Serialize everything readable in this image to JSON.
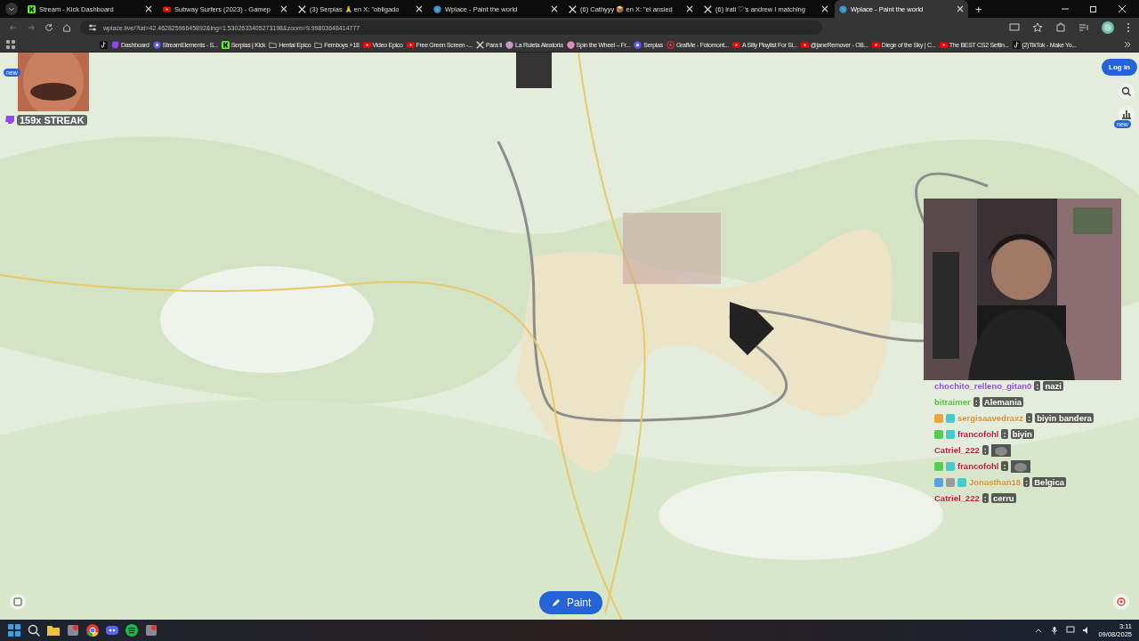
{
  "browser": {
    "tabs": [
      {
        "title": "Stream - Kick Dashboard",
        "kind": "kick",
        "selected": false
      },
      {
        "title": "Subway Surfers (2023) - Gamep",
        "kind": "youtube",
        "selected": false
      },
      {
        "title": "(3) Serpias 🙏 en X: \"obligado",
        "kind": "x",
        "selected": false
      },
      {
        "title": "Wplace - Paint the world",
        "kind": "globe",
        "selected": false
      },
      {
        "title": "(6) Cathyyy 📦 en X: \"el ansied",
        "kind": "x",
        "selected": false
      },
      {
        "title": "(6) irati ♡'s andrew I matching",
        "kind": "x",
        "selected": false
      },
      {
        "title": "Wplace - Paint the world",
        "kind": "globe",
        "selected": true
      }
    ],
    "new_tab": "+",
    "address": "wplace.live/?lat=42.46282596645892&lng=1.5302633405273198&zoom=9.99803648414777",
    "bookmarks": [
      {
        "kind": "tiktok"
      },
      {
        "label": "Dashboard",
        "kind": "twitch"
      },
      {
        "label": "StreamElements - S...",
        "kind": "se"
      },
      {
        "label": "Serpias | Kick",
        "kind": "kick"
      },
      {
        "label": "Hentai Epico",
        "kind": "folder"
      },
      {
        "label": "Femboys +18",
        "kind": "folder"
      },
      {
        "label": "Video Epico",
        "kind": "youtube"
      },
      {
        "label": "Free Green Screen -...",
        "kind": "youtube"
      },
      {
        "label": "Para ti",
        "kind": "x"
      },
      {
        "label": "La Ruleta Aleatoria",
        "kind": "wheel"
      },
      {
        "label": "Spin the Wheel – Fr...",
        "kind": "wheel"
      },
      {
        "label": "Serpias",
        "kind": "se"
      },
      {
        "label": "GrafMe - Fotomont...",
        "kind": "target"
      },
      {
        "label": "A Silly Playlist For Si...",
        "kind": "youtube"
      },
      {
        "label": "@janeRemover - OB...",
        "kind": "youtube"
      },
      {
        "label": "Diege of the Sky | C...",
        "kind": "youtube"
      },
      {
        "label": "The BEST CS2 Settin...",
        "kind": "youtube"
      },
      {
        "label": "(2)TikTok - Make Yo...",
        "kind": "tiktok"
      }
    ]
  },
  "page": {
    "login": "Log in",
    "new_badges": [
      "new",
      "new"
    ],
    "paint": "Paint"
  },
  "overlay": {
    "streak": "159x STREAK",
    "chat": [
      {
        "user": "chochito_relleno_gitan0",
        "color": "#8e4fd6",
        "colon": ":",
        "kind": "text",
        "message": "nazi"
      },
      {
        "user": "bitraimer",
        "color": "#4fc42e",
        "colon": ":",
        "kind": "text",
        "message": "Alemania"
      },
      {
        "user": "sergisaavedraxz",
        "color": "#d4902e",
        "badges": [
          {
            "kind": "gold"
          },
          {
            "kind": "cyan"
          }
        ],
        "colon": ":",
        "kind": "text",
        "message": "biyin bandera"
      },
      {
        "user": "francofohl",
        "color": "#b0203a",
        "badges": [
          {
            "kind": "green"
          },
          {
            "kind": "cyan"
          }
        ],
        "colon": ":",
        "kind": "text",
        "message": "biyin"
      },
      {
        "user": "Catriel_222",
        "color": "#b0203a",
        "colon": ":",
        "kind": "emote"
      },
      {
        "user": "francofohl",
        "color": "#b0203a",
        "badges": [
          {
            "kind": "green"
          },
          {
            "kind": "cyan"
          }
        ],
        "colon": ":",
        "kind": "emote"
      },
      {
        "user": "Jonasthan18",
        "color": "#d4902e",
        "badges": [
          {
            "kind": "blue"
          },
          {
            "kind": "grey"
          },
          {
            "kind": "cyan"
          }
        ],
        "colon": ":",
        "kind": "text",
        "message": "Belgica"
      },
      {
        "user": "Catriel_222",
        "color": "#b0203a",
        "colon": ":",
        "kind": "text",
        "message": "cerru"
      }
    ]
  },
  "taskbar": {
    "apps": [
      {
        "kind": "start"
      },
      {
        "kind": "search"
      },
      {
        "kind": "folder"
      },
      {
        "kind": "app"
      },
      {
        "kind": "chrome"
      },
      {
        "kind": "discord"
      },
      {
        "kind": "spotify"
      },
      {
        "kind": "app"
      }
    ],
    "time": "3:11",
    "date": "09/08/2025"
  }
}
